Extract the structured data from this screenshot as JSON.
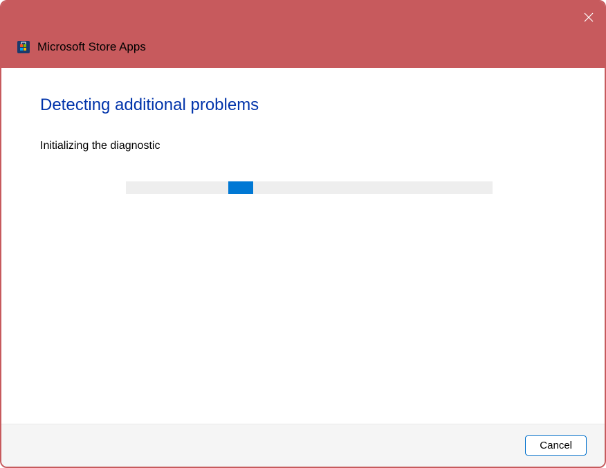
{
  "titlebar": {
    "app_name": "Microsoft Store Apps"
  },
  "content": {
    "heading": "Detecting additional problems",
    "status": "Initializing the diagnostic"
  },
  "footer": {
    "cancel_label": "Cancel"
  },
  "colors": {
    "accent_red": "#c75a5d",
    "link_blue": "#0033aa",
    "progress_blue": "#0078d4"
  }
}
